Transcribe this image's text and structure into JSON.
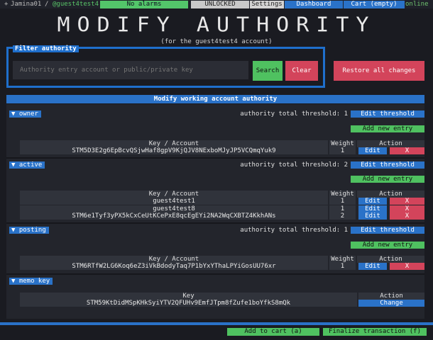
{
  "topbar": {
    "plus": "+",
    "user": "Jamina01",
    "slash": "/",
    "account": "@guest4test4",
    "alarms": "No alarms",
    "lock_status": "UNLOCKED",
    "settings": "Settings",
    "dashboard": "Dashboard",
    "cart": "Cart (empty)",
    "online": "online"
  },
  "title": "MODIFY AUTHORITY",
  "subtitle": "(for the guest4test4 account)",
  "filter": {
    "label": "Filter authority",
    "placeholder": "Authority entry account or public/private key",
    "search_label": "Search",
    "clear_label": "Clear"
  },
  "restore_label": "Restore all changes",
  "section_title": "Modify working account authority",
  "headers": {
    "key_account": "Key / Account",
    "key": "Key",
    "weight": "Weight",
    "action": "Action"
  },
  "buttons": {
    "edit_threshold": "Edit threshold",
    "add_entry": "Add new entry",
    "edit": "Edit",
    "delete": "X",
    "change": "Change"
  },
  "roles": {
    "owner": {
      "label": "▼ owner",
      "threshold_text": "authority total threshold: 1",
      "entries": [
        {
          "key": "STM5D3E2g6EpBcvQSjwHaf8gpV9KjQJV8NExboMJyJP5VCQmqYuk9",
          "weight": "1"
        }
      ]
    },
    "active": {
      "label": "▼ active",
      "threshold_text": "authority total threshold: 2",
      "entries": [
        {
          "key": "guest4test1",
          "weight": "1"
        },
        {
          "key": "guest4test8",
          "weight": "1"
        },
        {
          "key": "STM6e1Tyf3yPX5kCxCeUtKCePxE8qcEgEYi2NA2WqCXBTZ4KkhANs",
          "weight": "2"
        }
      ]
    },
    "posting": {
      "label": "▼ posting",
      "threshold_text": "authority total threshold: 1",
      "entries": [
        {
          "key": "STM6RTfW2LG6Koq6eZ3iVkBdodyTaq7P1bYxYThaLPYiGosUU76xr",
          "weight": "1"
        }
      ]
    },
    "memo": {
      "label": "▼ memo key",
      "key": "STM59KtDidMSpKHkSyiYTV2QFUHv9EmfJTpm8fZufe1boYfkS8mQk"
    }
  },
  "bottom": {
    "add_to_cart": "Add to cart (a)",
    "finalize": "Finalize transaction (f)"
  },
  "colors": {
    "accent_blue": "#2a72c8",
    "green": "#4fc160",
    "red": "#d3445b",
    "background": "#1a1b21"
  }
}
